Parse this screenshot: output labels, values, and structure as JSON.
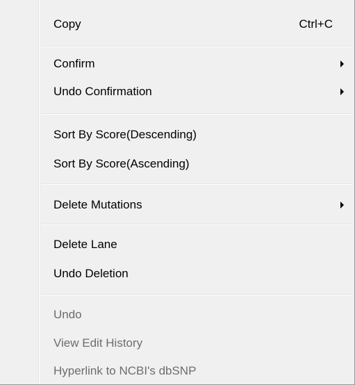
{
  "menu": {
    "items": [
      {
        "label": "Copy",
        "shortcut": "Ctrl+C"
      },
      {
        "label": "Confirm"
      },
      {
        "label": "Undo Confirmation"
      },
      {
        "label": "Sort By Score(Descending)"
      },
      {
        "label": "Sort By Score(Ascending)"
      },
      {
        "label": "Delete Mutations"
      },
      {
        "label": "Delete Lane"
      },
      {
        "label": "Undo Deletion"
      },
      {
        "label": "Undo"
      },
      {
        "label": "View Edit History"
      },
      {
        "label": "Hyperlink to NCBI's dbSNP"
      }
    ]
  },
  "colors": {
    "menu_background": "#f0f0f0",
    "text": "#000000",
    "disabled_text": "#6d6d6d",
    "separator": "#e2e3e3"
  }
}
